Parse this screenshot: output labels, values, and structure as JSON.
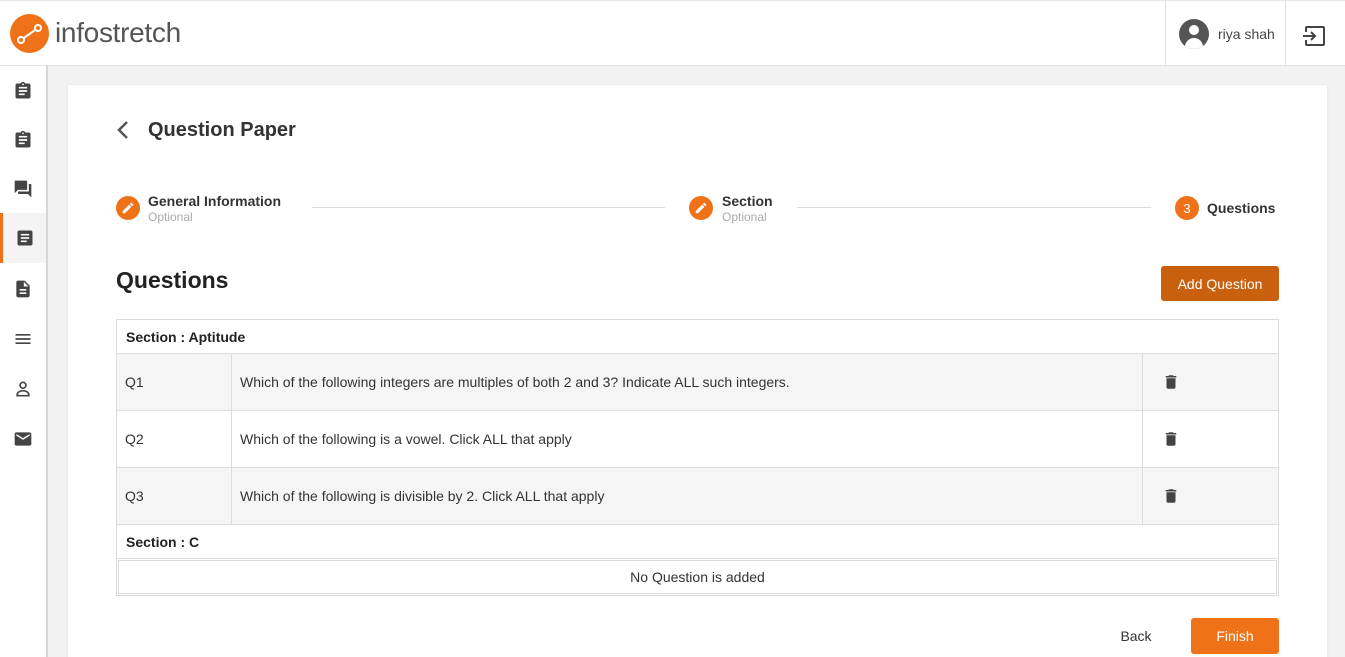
{
  "brand": {
    "name": "infostretch",
    "accent": "#ef7218",
    "button_dark": "#c9600e"
  },
  "header": {
    "user_name": "riya shah",
    "logout_icon": "logout-icon"
  },
  "sidebar": {
    "items": [
      {
        "icon": "clipboard-icon"
      },
      {
        "icon": "clipboard-icon"
      },
      {
        "icon": "forum-icon"
      },
      {
        "icon": "list-alt-icon",
        "active": true
      },
      {
        "icon": "document-icon"
      },
      {
        "icon": "menu-icon"
      },
      {
        "icon": "person-icon"
      },
      {
        "icon": "mail-icon"
      }
    ]
  },
  "page": {
    "title": "Question Paper",
    "back_icon": "chevron-left-icon"
  },
  "stepper": {
    "steps": [
      {
        "title": "General Information",
        "subtitle": "Optional",
        "icon": "edit-icon"
      },
      {
        "title": "Section",
        "subtitle": "Optional",
        "icon": "edit-icon"
      },
      {
        "number": "3",
        "title": "Questions"
      }
    ]
  },
  "questions": {
    "heading": "Questions",
    "add_label": "Add Question",
    "sections": [
      {
        "label": "Section : Aptitude",
        "items": [
          {
            "num": "Q1",
            "text": "Which of the following integers are multiples of both 2 and 3? Indicate ALL such integers."
          },
          {
            "num": "Q2",
            "text": "Which of the following is a vowel. Click ALL that apply"
          },
          {
            "num": "Q3",
            "text": "Which of the following is divisible by 2. Click ALL that apply"
          }
        ]
      },
      {
        "label": "Section : C",
        "empty_text": "No Question is added"
      }
    ]
  },
  "footer": {
    "back_label": "Back",
    "finish_label": "Finish"
  }
}
